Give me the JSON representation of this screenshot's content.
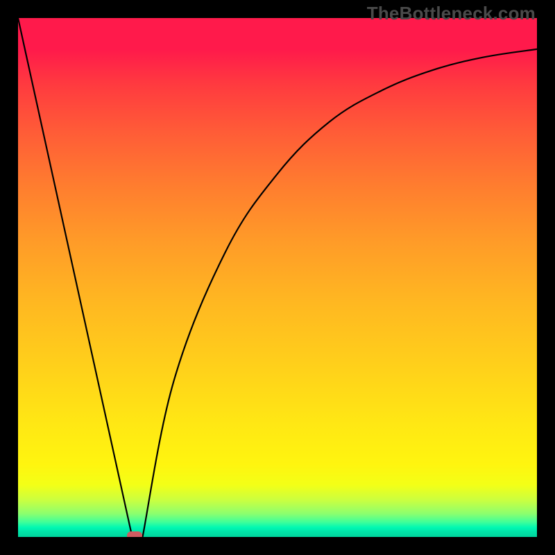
{
  "watermark": "TheBottleneck.com",
  "chart_data": {
    "type": "line",
    "title": "",
    "xlabel": "",
    "ylabel": "",
    "xlim": [
      0,
      100
    ],
    "ylim": [
      0,
      100
    ],
    "series": [
      {
        "name": "bottleneck-curve",
        "x": [
          0,
          22,
          24,
          30,
          40,
          50,
          60,
          70,
          80,
          90,
          100
        ],
        "values": [
          100,
          0,
          0,
          30,
          55,
          70,
          80,
          86,
          90,
          92.5,
          94
        ]
      }
    ],
    "annotations": [
      {
        "name": "optimal-marker",
        "x": 22.5,
        "y": 0
      }
    ],
    "background_gradient": {
      "top": "#ff1a4b",
      "mid": "#ffd21a",
      "bottom": "#00d49d"
    }
  }
}
